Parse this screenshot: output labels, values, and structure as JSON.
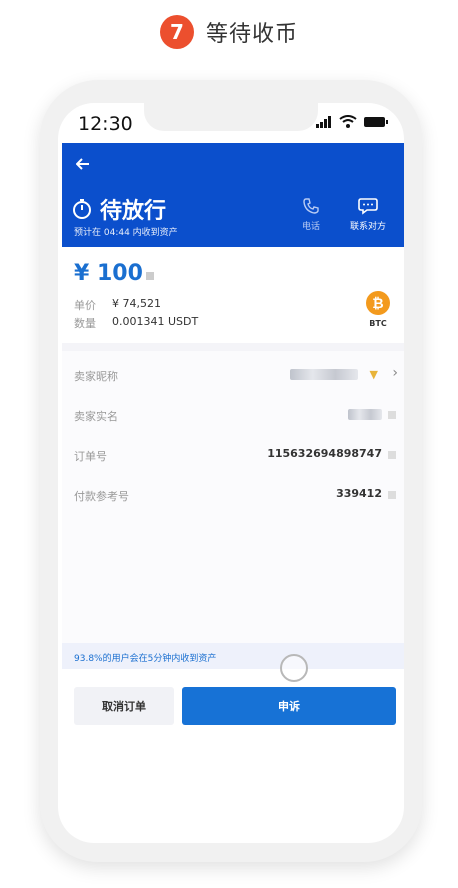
{
  "step": {
    "number": "7",
    "title": "等待收币"
  },
  "statusbar": {
    "time": "12:30"
  },
  "appbar": {
    "title": "待放行",
    "subtitle": "预计在 04:44 内收到资产",
    "actions": [
      {
        "label": "电话",
        "icon": "phone-icon"
      },
      {
        "label": "联系对方",
        "icon": "chat-icon"
      }
    ]
  },
  "order": {
    "amount": "¥ 100",
    "price_label": "单价",
    "price_value": "¥ 74,521",
    "quantity_label": "数量",
    "quantity_value": "0.001341 USDT",
    "coin": {
      "symbol": "₿",
      "label": "BTC",
      "color": "#f39a1d"
    }
  },
  "details": {
    "seller_nickname_label": "卖家昵称",
    "seller_realname_label": "卖家实名",
    "order_no_label": "订单号",
    "order_no_value": "115632694898747",
    "ref_label": "付款参考号",
    "ref_value": "339412"
  },
  "notice": "93.8%的用户会在5分钟内收到资产",
  "buttons": {
    "cancel": "取消订单",
    "appeal": "申诉"
  },
  "colors": {
    "brand_blue": "#0b4fcc",
    "accent_blue": "#1772d6",
    "step_badge": "#ec4f2e"
  }
}
